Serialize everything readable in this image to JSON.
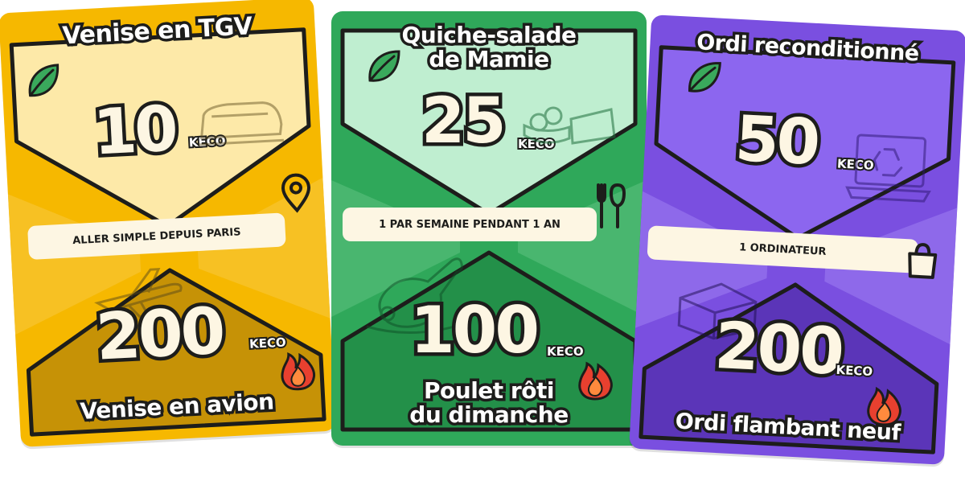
{
  "cards": [
    {
      "top_title": "Venise en TGV",
      "top_value": "10",
      "top_unit": "KECO",
      "note": "ALLER SIMPLE DEPUIS PARIS",
      "bottom_value": "200",
      "bottom_unit": "KECO",
      "bottom_title": "Venise en avion",
      "colors": {
        "bg": "#f6b800",
        "top": "#fde9a8",
        "bottom": "#c69206"
      },
      "icons": [
        "leaf-icon",
        "train-icon",
        "location-pin-icon",
        "plane-icon",
        "fire-icon"
      ]
    },
    {
      "top_title_line1": "Quiche-salade",
      "top_title_line2": "de Mamie",
      "top_value": "25",
      "top_unit": "KECO",
      "note": "1 par semaine pendant 1 an",
      "bottom_value": "100",
      "bottom_unit": "KECO",
      "bottom_title_line1": "Poulet rôti",
      "bottom_title_line2": "du dimanche",
      "colors": {
        "bg": "#2fa85a",
        "top": "#bfeed0",
        "bottom": "#239049"
      },
      "icons": [
        "leaf-icon",
        "salad-icon",
        "cutlery-icon",
        "chicken-icon",
        "fire-icon"
      ]
    },
    {
      "top_title": "Ordi reconditionné",
      "top_value": "50",
      "top_unit": "KECO",
      "note": "1 ordinateur",
      "bottom_value": "200",
      "bottom_unit": "KECO",
      "bottom_title": "Ordi flambant neuf",
      "colors": {
        "bg": "#7a4fe0",
        "top": "#8c66ef",
        "bottom": "#5b35b8"
      },
      "icons": [
        "leaf-icon",
        "recycled-laptop-icon",
        "shopping-bag-icon",
        "laptop-box-icon",
        "fire-icon"
      ]
    }
  ]
}
